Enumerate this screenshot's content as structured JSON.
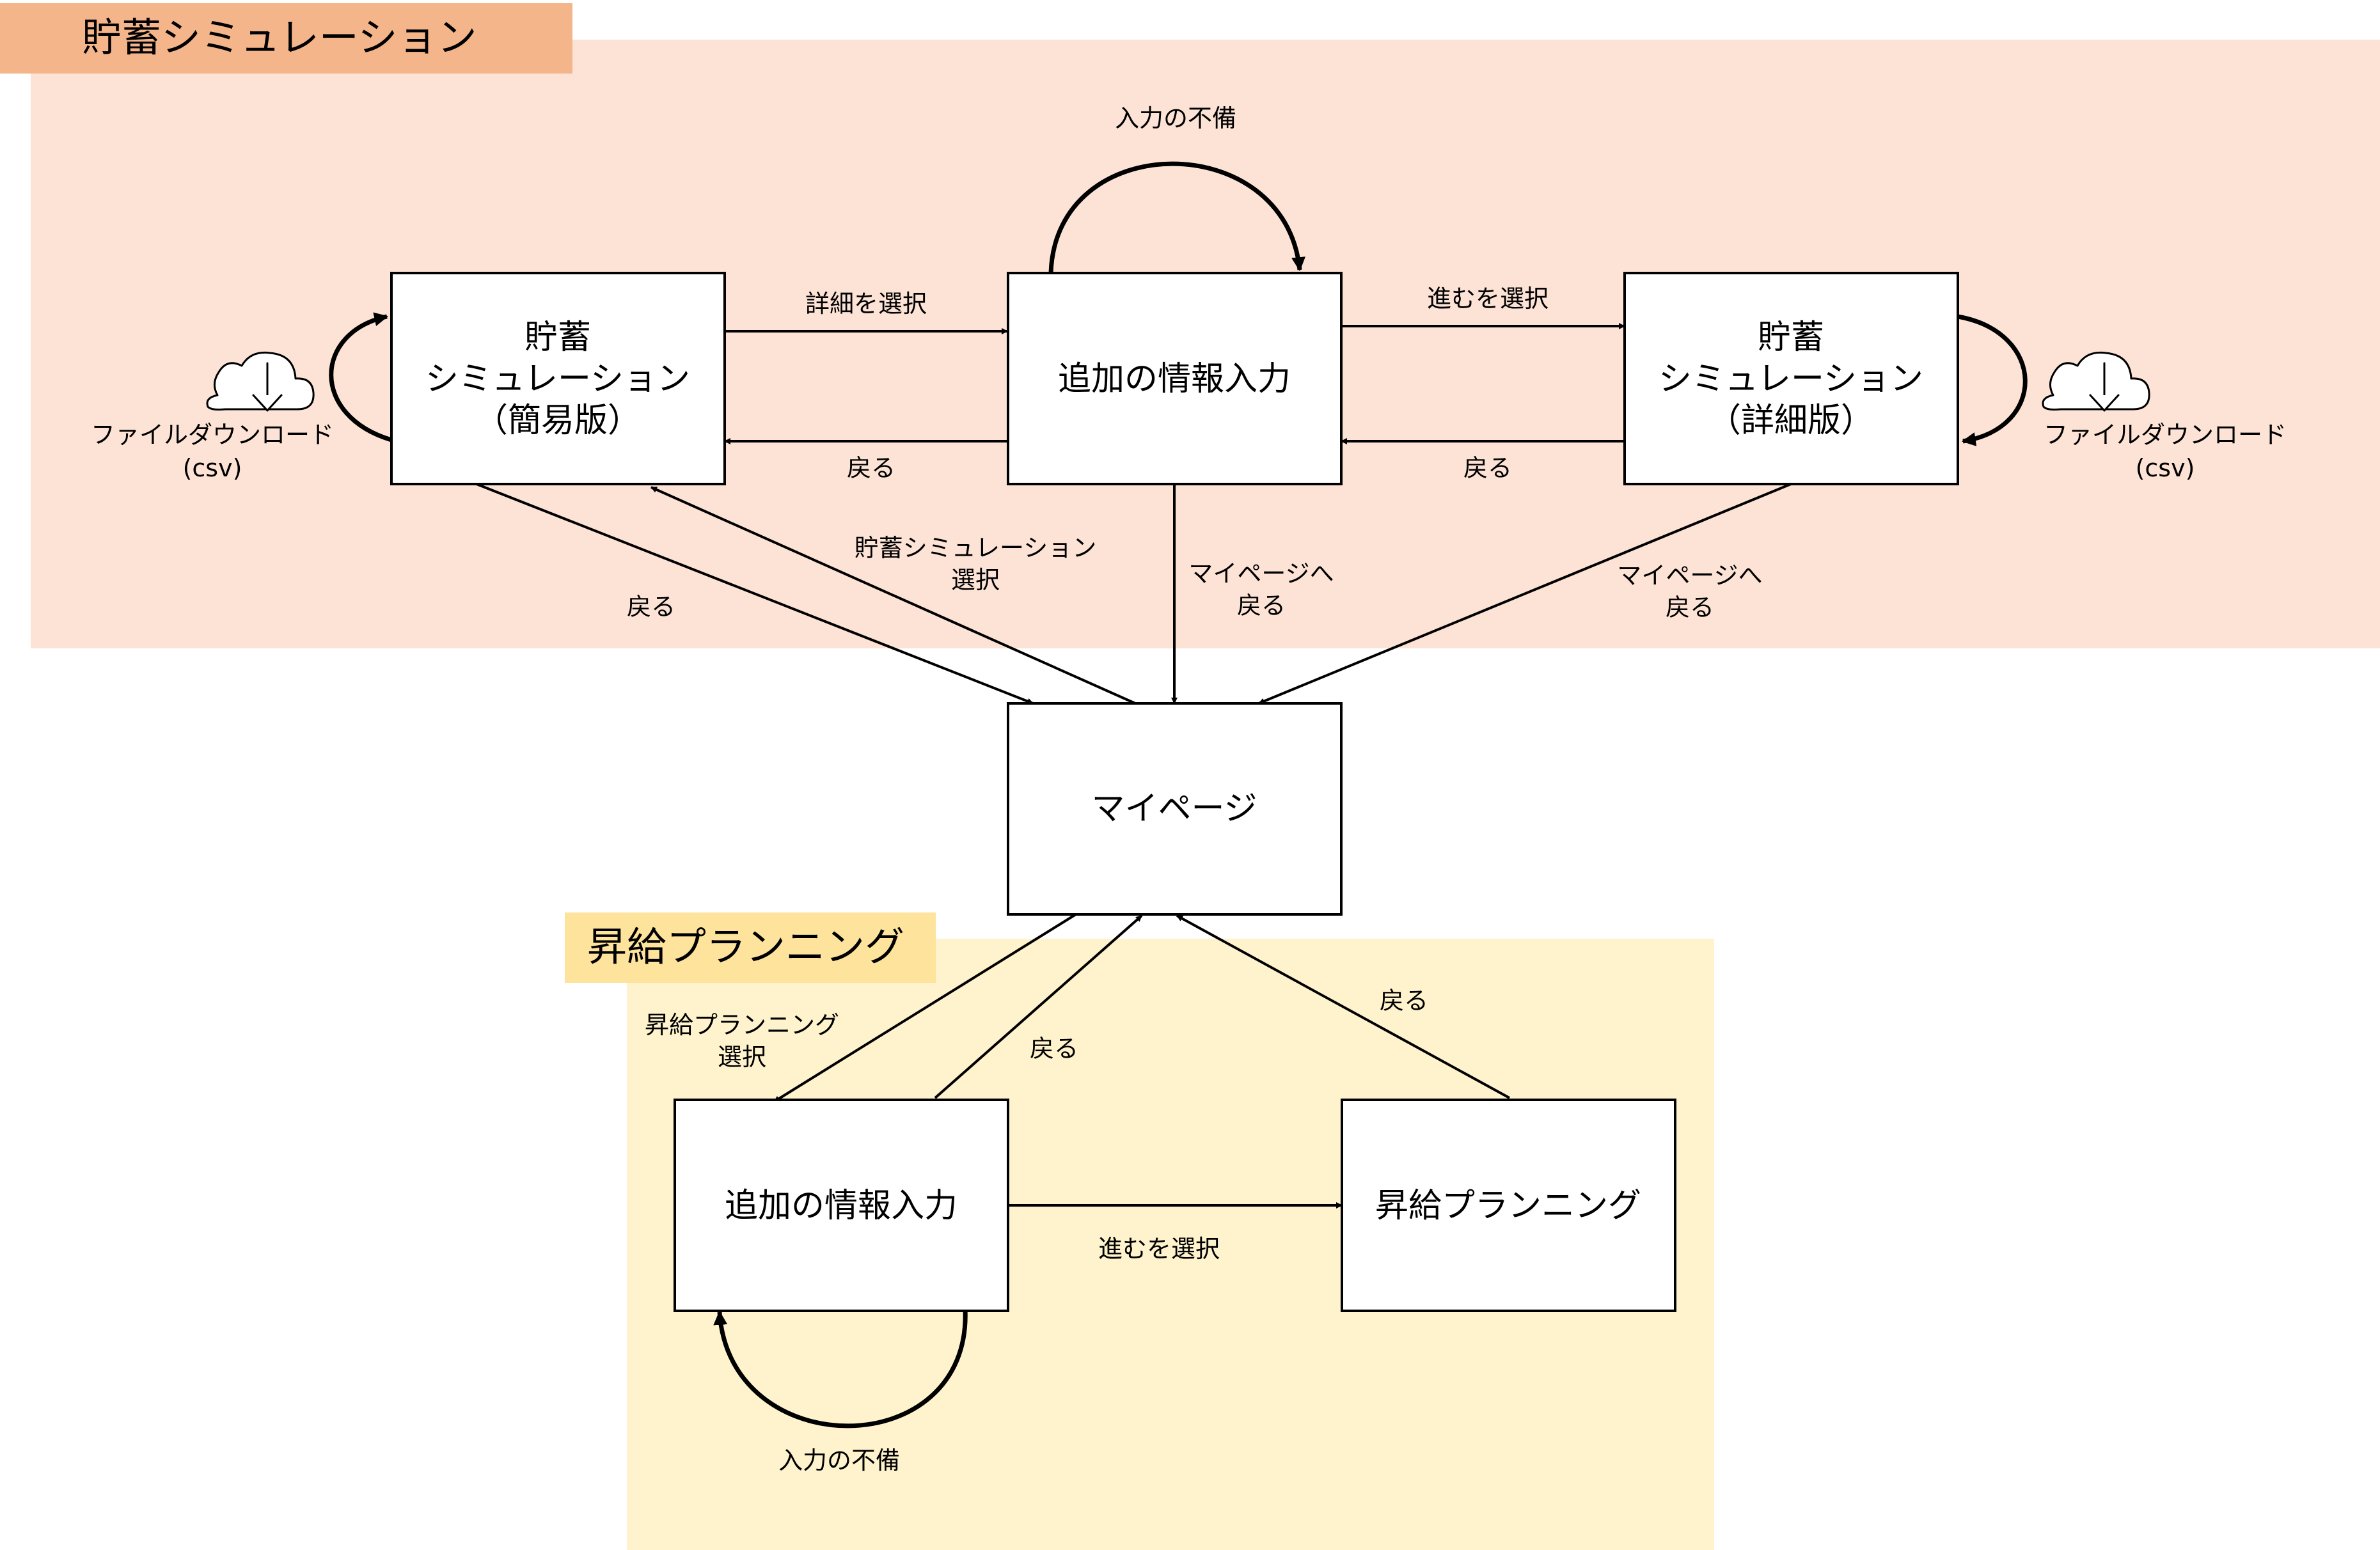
{
  "groups": {
    "savings": {
      "title": "貯蓄シミュレーション",
      "fill": "#fce3d6",
      "tab": "#f5b58a"
    },
    "raise": {
      "title": "昇給プランニング",
      "fill": "#fef3cd",
      "tab": "#fde39c"
    }
  },
  "nodes": {
    "simple": [
      "貯蓄",
      "シミュレーション",
      "（簡易版）"
    ],
    "input_top": [
      "追加の情報入力"
    ],
    "detail": [
      "貯蓄",
      "シミュレーション",
      "（詳細版）"
    ],
    "mypage": [
      "マイページ"
    ],
    "input_bottom": [
      "追加の情報入力"
    ],
    "raise_plan": [
      "昇給プランニング"
    ]
  },
  "edges": {
    "to_detail_input": [
      "詳細を選択"
    ],
    "back_simple": [
      "戻る"
    ],
    "proceed_top": [
      "進むを選択"
    ],
    "back_detail_input": [
      "戻る"
    ],
    "input_error_top": [
      "入力の不備"
    ],
    "simple_to_mypage": [
      "戻る"
    ],
    "mypage_to_simple": [
      "貯蓄シミュレーション",
      "選択"
    ],
    "input_to_mypage": [
      "マイページへ",
      "戻る"
    ],
    "detail_to_mypage": [
      "マイページへ",
      "戻る"
    ],
    "download_left": [
      "ファイルダウンロード",
      "(csv)"
    ],
    "download_right": [
      "ファイルダウンロード",
      "(csv)"
    ],
    "mypage_to_raise": [
      "昇給プランニング",
      "選択"
    ],
    "input_back_mypage": [
      "戻る"
    ],
    "raise_back_mypage": [
      "戻る"
    ],
    "proceed_bottom": [
      "進むを選択"
    ],
    "input_error_bottom": [
      "入力の不備"
    ]
  },
  "icons": {
    "download": "cloud-download-icon"
  }
}
